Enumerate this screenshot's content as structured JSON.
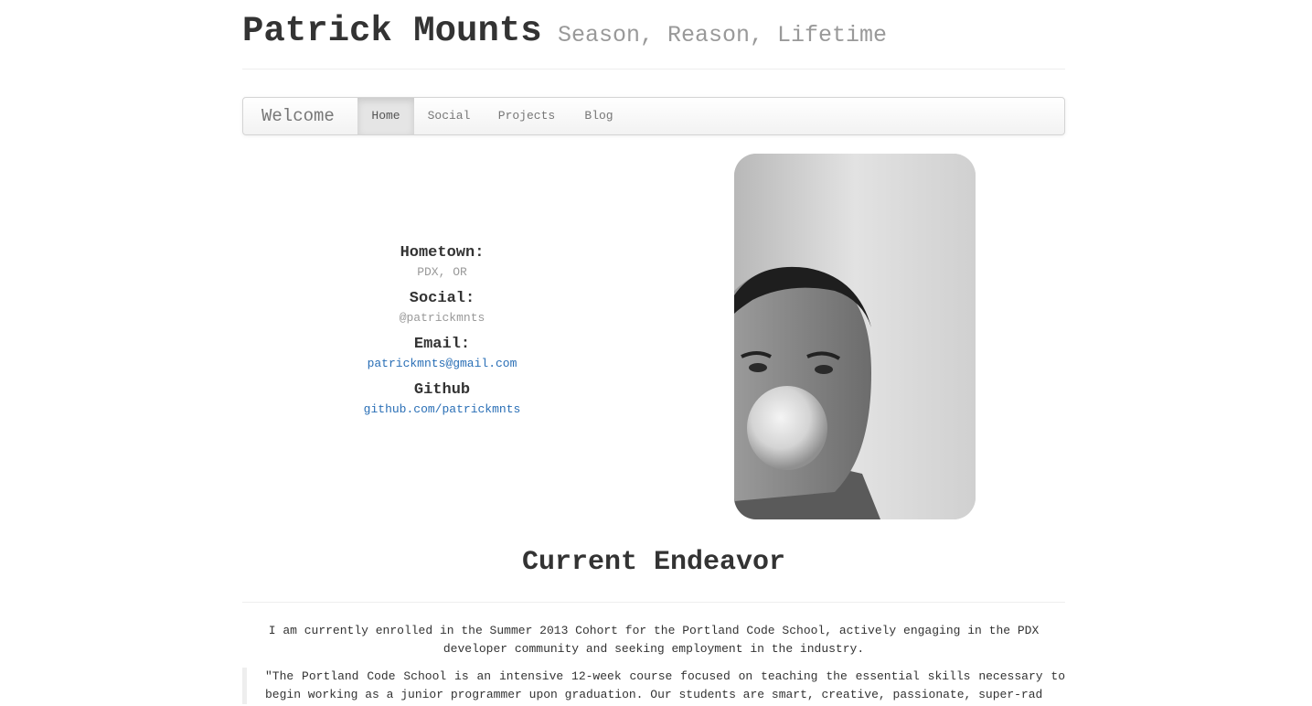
{
  "header": {
    "title": "Patrick Mounts",
    "tagline": "Season, Reason, Lifetime"
  },
  "navbar": {
    "brand": "Welcome",
    "items": [
      {
        "label": "Home",
        "active": true
      },
      {
        "label": "Social",
        "active": false
      },
      {
        "label": "Projects",
        "active": false
      },
      {
        "label": "Blog",
        "active": false
      }
    ]
  },
  "info": {
    "hometown_label": "Hometown:",
    "hometown_value": "PDX, OR",
    "social_label": "Social:",
    "social_value": "@patrickmnts",
    "email_label": "Email:",
    "email_value": "patrickmnts@gmail.com",
    "github_label": "Github",
    "github_value": "github.com/patrickmnts"
  },
  "section": {
    "title": "Current Endeavor",
    "intro": "I am currently enrolled in the Summer 2013 Cohort for the Portland Code School, actively engaging in the PDX developer community and seeking employment in the industry.",
    "quote": "\"The Portland Code School is an intensive 12-week course focused on teaching the essential skills necessary to begin working as a junior programmer upon graduation. Our students are smart, creative, passionate, super-rad"
  },
  "colors": {
    "link": "#2a6fb6",
    "muted": "#999999",
    "text": "#333333"
  }
}
